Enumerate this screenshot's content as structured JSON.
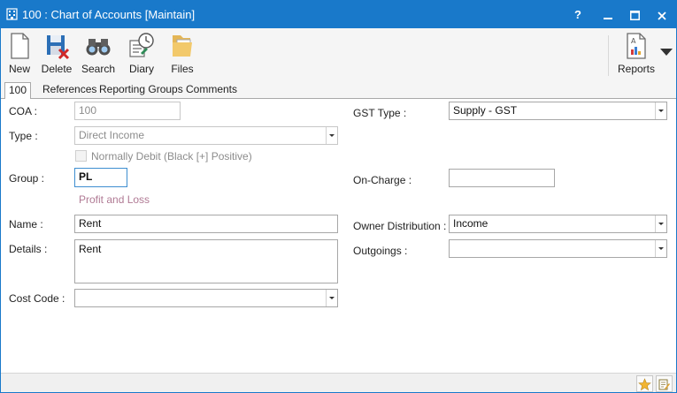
{
  "window": {
    "title": "100 : Chart of Accounts [Maintain]",
    "controls": {
      "help": "?",
      "minimize": "—",
      "maximize": "☐",
      "close": "✕"
    },
    "accent": "#1979ca"
  },
  "toolbar": {
    "new_label": "New",
    "delete_label": "Delete",
    "search_label": "Search",
    "diary_label": "Diary",
    "files_label": "Files",
    "reports_label": "Reports"
  },
  "tabs": [
    {
      "label": "100"
    },
    {
      "label": "References"
    },
    {
      "label": "Reporting Groups"
    },
    {
      "label": "Comments"
    }
  ],
  "form": {
    "coa": {
      "label": "COA :",
      "value": "100"
    },
    "type": {
      "label": "Type :",
      "value": "Direct Income"
    },
    "normally_debit": {
      "label": "Normally Debit (Black [+] Positive)",
      "checked": false
    },
    "group": {
      "label": "Group :",
      "value": "PL",
      "description": "Profit and Loss",
      "description_color": "#b07a94"
    },
    "name": {
      "label": "Name :",
      "value": "Rent"
    },
    "details": {
      "label": "Details :",
      "value": "Rent"
    },
    "cost_code": {
      "label": "Cost Code :",
      "value": ""
    },
    "gst_type": {
      "label": "GST Type :",
      "value": "Supply - GST"
    },
    "on_charge": {
      "label": "On-Charge :",
      "value": ""
    },
    "owner_distribution": {
      "label": "Owner Distribution :",
      "value": "Income"
    },
    "outgoings": {
      "label": "Outgoings :",
      "value": ""
    }
  },
  "statusbar": {
    "favourite_icon": "star-icon",
    "notes_icon": "edit-note-icon"
  }
}
